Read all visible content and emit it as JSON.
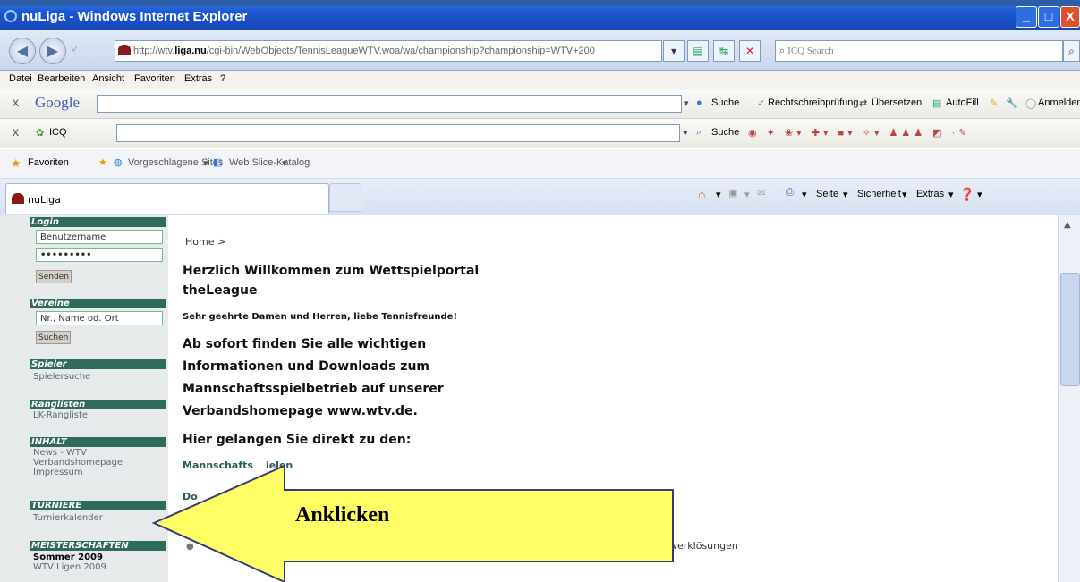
{
  "window": {
    "title": "nuLiga - Windows Internet Explorer",
    "min": "_",
    "max": "□",
    "close": "X"
  },
  "address": {
    "url_prefix": "http://wtv.",
    "url_domain": "liga.nu",
    "url_rest": "/cgi-bin/WebObjects/TennisLeagueWTV.woa/wa/championship?championship=WTV+200",
    "search_placeholder": "ICQ Search"
  },
  "menu": [
    "Datei",
    "Bearbeiten",
    "Ansicht",
    "Favoriten",
    "Extras",
    "?"
  ],
  "google_toolbar": {
    "close": "x",
    "brand": "Google",
    "search": "Suche",
    "spellcheck": "Rechtschreibprüfung",
    "translate": "Übersetzen",
    "autofill": "AutoFill",
    "signin": "Anmelden"
  },
  "icq_toolbar": {
    "close": "x",
    "brand": "ICQ",
    "search": "Suche"
  },
  "favorites": {
    "label": "Favoriten",
    "suggested": "Vorgeschlagene Sites",
    "webslice": "Web Slice-Katalog"
  },
  "tab": {
    "title": "nuLiga"
  },
  "command_bar": {
    "page": "Seite",
    "security": "Sicherheit",
    "extras": "Extras"
  },
  "sidebar": {
    "login_head": "Login",
    "username": "Benutzername",
    "password": "•••••••••",
    "send": "Senden",
    "clubs_head": "Vereine",
    "club_placeholder": "Nr., Name od. Ort",
    "search": "Suchen",
    "players_head": "Spieler",
    "player_search": "Spielersuche",
    "rankings_head": "Ranglisten",
    "lk_ranking": "LK-Rangliste",
    "content_head": "INHALT",
    "news": "News - WTV",
    "association_home": "Verbandshomepage",
    "imprint": "Impressum",
    "tournaments_head": "TURNIERE",
    "tournament_calendar": "Turnierkalender",
    "championships_head": "MEISTERSCHAFTEN",
    "summer": "Sommer 2009",
    "wtv_leagues": "WTV Ligen 2009"
  },
  "content": {
    "breadcrumb": "Home >",
    "welcome_line1": "Herzlich Willkommen zum Wettspielportal",
    "welcome_line2": "theLeague",
    "greeting": "Sehr geehrte Damen und Herren, liebe Tennisfreunde!",
    "info_line1": "Ab sofort finden Sie alle wichtigen",
    "info_line2": "Informationen und Downloads zum",
    "info_line3": "Mannschaftsspielbetrieb auf unserer",
    "info_line4": "Verbandshomepage www.wtv.de.",
    "direct_heading": "Hier gelangen Sie direkt zu den:",
    "link_team_games_a": "Mannschafts",
    "link_team_games_b": "ielen",
    "link_downloads_partial": "Do",
    "partial_text": "werklösungen"
  },
  "annotation": {
    "label": "Anklicken",
    "arrow_color": "#ffff66"
  },
  "colors": {
    "titlebar": "#1c57d0",
    "sidebar_header": "#2f6a5c",
    "link": "#2b5e52"
  }
}
